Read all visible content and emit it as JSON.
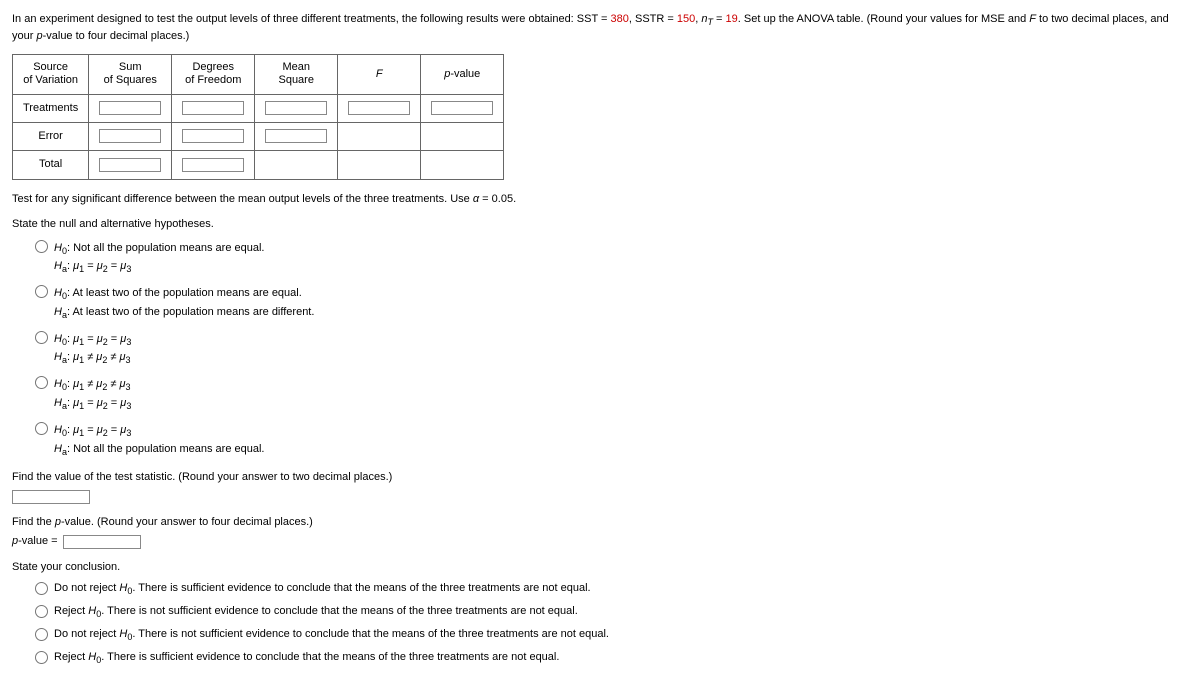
{
  "intro": {
    "p1": "In an experiment designed to test the output levels of three different treatments, the following results were obtained: SST = ",
    "v1": "380",
    "p2": ", SSTR = ",
    "v2": "150",
    "p3": ", ",
    "nT_label": "n",
    "nT_sub": "T",
    "p4": " = ",
    "v3": "19",
    "p5": ". Set up the ANOVA table. (Round your values for MSE and ",
    "F": "F",
    "p6": " to two decimal places, and your ",
    "pval": "p",
    "p7": "-value to four decimal places.)"
  },
  "table": {
    "h1a": "Source",
    "h1b": "of Variation",
    "h2a": "Sum",
    "h2b": "of Squares",
    "h3a": "Degrees",
    "h3b": "of Freedom",
    "h4a": "Mean",
    "h4b": "Square",
    "h5": "F",
    "h6a": "p",
    "h6b": "-value",
    "r1": "Treatments",
    "r2": "Error",
    "r3": "Total"
  },
  "test_line_a": "Test for any significant difference between the mean output levels of the three treatments. Use ",
  "alpha_sym": "α",
  "alpha_eq": " = 0.05.",
  "state_hyp": "State the null and alternative hypotheses.",
  "opt1_l1_a": "H",
  "opt1_l1_sub": "0",
  "opt1_l1_b": ": Not all the population means are equal.",
  "opt1_l2_a": "H",
  "opt1_l2_sub": "a",
  "opt1_l2_b": ": ",
  "opt1_l2_mu": "μ",
  "opt1_l2_eq": " = ",
  "opt2_l1_a": "H",
  "opt2_l1_sub": "0",
  "opt2_l1_b": ": At least two of the population means are equal.",
  "opt2_l2_a": "H",
  "opt2_l2_sub": "a",
  "opt2_l2_b": ": At least two of the population means are different.",
  "opt3_l1": "H",
  "opt3_l1s": "0",
  "opt3_colon": ": ",
  "opt3_l2": "H",
  "opt3_l2s": "a",
  "mu": "μ",
  "s1": "1",
  "s2": "2",
  "s3": "3",
  "eq": " = ",
  "ne": " ≠ ",
  "opt5_l2_b": ": Not all the population means are equal.",
  "find_ts": "Find the value of the test statistic. (Round your answer to two decimal places.)",
  "find_p_a": "Find the ",
  "find_p_b": "-value. (Round your answer to four decimal places.)",
  "pval_label_a": "p",
  "pval_label_b": "-value = ",
  "state_conc": "State your conclusion.",
  "c1a": "Do not reject ",
  "H": "H",
  "zero": "0",
  "c1b": ". There is sufficient evidence to conclude that the means of the three treatments are not equal.",
  "c2a": "Reject ",
  "c2b": ". There is not sufficient evidence to conclude that the means of the three treatments are not equal.",
  "c3a": "Do not reject ",
  "c3b": ". There is not sufficient evidence to conclude that the means of the three treatments are not equal.",
  "c4a": "Reject ",
  "c4b": ". There is sufficient evidence to conclude that the means of the three treatments are not equal."
}
